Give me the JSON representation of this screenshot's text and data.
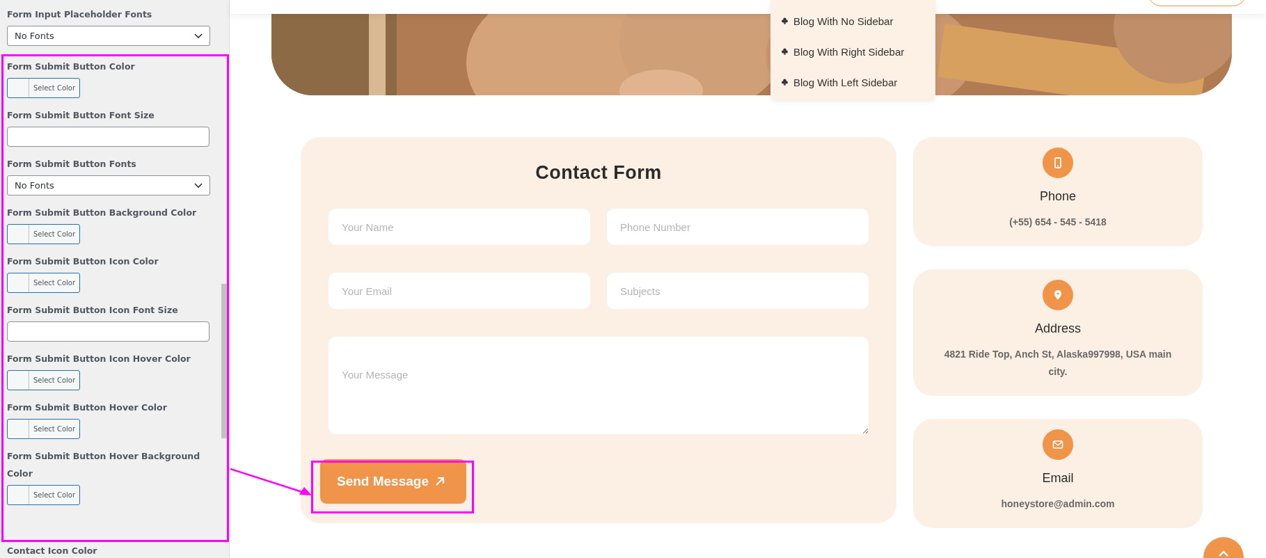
{
  "settings_panel": {
    "top_items": [
      {
        "kind": "select",
        "label": "Form Input Placeholder Fonts",
        "value": "No Fonts"
      }
    ],
    "highlighted_items": [
      {
        "kind": "color",
        "label": "Form Submit Button Color",
        "button": "Select Color"
      },
      {
        "kind": "text",
        "label": "Form Submit Button Font Size"
      },
      {
        "kind": "select",
        "label": "Form Submit Button Fonts",
        "value": "No Fonts"
      },
      {
        "kind": "color",
        "label": "Form Submit Button Background Color",
        "button": "Select Color"
      },
      {
        "kind": "color",
        "label": "Form Submit Button Icon Color",
        "button": "Select Color"
      },
      {
        "kind": "text",
        "label": "Form Submit Button Icon Font Size"
      },
      {
        "kind": "color",
        "label": "Form Submit Button Icon Hover Color",
        "button": "Select Color"
      },
      {
        "kind": "color",
        "label": "Form Submit Button Hover Color",
        "button": "Select Color"
      },
      {
        "kind": "color",
        "label": "Form Submit Button Hover Background Color",
        "button": "Select Color"
      }
    ],
    "bottom_items": [
      {
        "label": "Contact Icon Color"
      }
    ]
  },
  "dropdown": {
    "items": [
      "Blog With No Sidebar",
      "Blog With Right Sidebar",
      "Blog With Left Sidebar"
    ]
  },
  "contact_form": {
    "title": "Contact Form",
    "fields": [
      {
        "kind": "input",
        "placeholder": "Your Name"
      },
      {
        "kind": "input",
        "placeholder": "Phone Number"
      },
      {
        "kind": "input",
        "placeholder": "Your Email"
      },
      {
        "kind": "input",
        "placeholder": "Subjects"
      },
      {
        "kind": "textarea",
        "placeholder": "Your Message"
      }
    ],
    "submit": "Send Message"
  },
  "info_cards": [
    {
      "kind": "phone",
      "title": "Phone",
      "text": "(+55) 654 - 545 - 5418"
    },
    {
      "kind": "address",
      "title": "Address",
      "text": "4821 Ride Top, Anch St, Alaska997998, USA main city."
    },
    {
      "kind": "email",
      "title": "Email",
      "text": "honeystore@admin.com"
    }
  ]
}
